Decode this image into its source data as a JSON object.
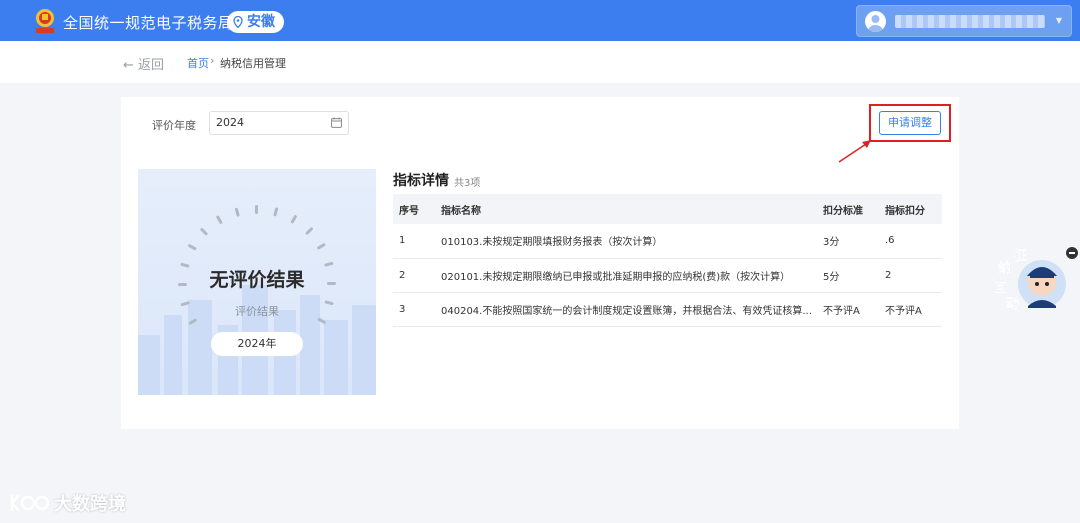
{
  "header": {
    "site_title": "全国统一规范电子税务局",
    "region": "安徽",
    "user_caret": "▼"
  },
  "breadcrumb": {
    "back_label": "← 返回",
    "home": "首页",
    "separator": "›",
    "current": "纳税信用管理"
  },
  "filter": {
    "year_label": "评价年度",
    "year_value": "2024"
  },
  "toolbar": {
    "apply_label": "申请调整"
  },
  "result": {
    "title": "无评价结果",
    "subtitle": "评价结果",
    "year": "2024年"
  },
  "details": {
    "title": "指标详情",
    "count": "共3项",
    "columns": [
      "序号",
      "指标名称",
      "扣分标准",
      "指标扣分"
    ],
    "rows": [
      [
        "1",
        "010103.未按规定期限填报财务报表（按次计算）",
        "3分",
        ".6"
      ],
      [
        "2",
        "020101.未按规定期限缴纳已申报或批准延期申报的应纳税(费)款（按次计算）",
        "5分",
        "2"
      ],
      [
        "3",
        "040204.不能按照国家统一的会计制度规定设置账簿，并根据合法、有效凭证核算...",
        "不予评A",
        "不予评A"
      ]
    ]
  },
  "widget": {
    "chars": [
      "征",
      "纳",
      "互",
      "动"
    ]
  },
  "watermark": {
    "text": "大数跨境"
  },
  "colors": {
    "brand": "#3c7ef0",
    "highlight": "#e02020"
  }
}
